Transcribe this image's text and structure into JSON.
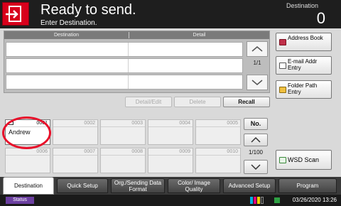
{
  "header": {
    "title": "Ready to send.",
    "subtitle": "Enter Destination.",
    "destination_label": "Destination",
    "destination_count": "0"
  },
  "table": {
    "columns": [
      "Destination",
      "Detail"
    ],
    "page_indicator": "1/1"
  },
  "side_buttons": [
    {
      "label": "Address Book"
    },
    {
      "label": "E-mail Addr Entry"
    },
    {
      "label": "Folder Path Entry"
    }
  ],
  "actions": {
    "detail_edit": "Detail/Edit",
    "delete": "Delete",
    "recall": "Recall"
  },
  "quick_keys": {
    "tiles": [
      {
        "number": "0001",
        "name": "Andrew",
        "active": true
      },
      {
        "number": "0002",
        "name": "",
        "active": false
      },
      {
        "number": "0003",
        "name": "",
        "active": false
      },
      {
        "number": "0004",
        "name": "",
        "active": false
      },
      {
        "number": "0005",
        "name": "",
        "active": false
      },
      {
        "number": "0006",
        "name": "",
        "active": false
      },
      {
        "number": "0007",
        "name": "",
        "active": false
      },
      {
        "number": "0008",
        "name": "",
        "active": false
      },
      {
        "number": "0009",
        "name": "",
        "active": false
      },
      {
        "number": "0010",
        "name": "",
        "active": false
      }
    ],
    "no_button": "No.",
    "page_indicator": "1/100",
    "wsd_scan": "WSD Scan"
  },
  "tabs": [
    {
      "label": "Destination",
      "active": true
    },
    {
      "label": "Quick Setup",
      "active": false
    },
    {
      "label": "Org./Sending Data Format",
      "active": false
    },
    {
      "label": "Color/ Image Quality",
      "active": false
    },
    {
      "label": "Advanced Setup",
      "active": false
    },
    {
      "label": "Program",
      "active": false
    }
  ],
  "status_bar": {
    "status_label": "Status",
    "datetime": "03/26/2020 13:26"
  },
  "colors": {
    "accent_red": "#d8001c",
    "highlight_ring": "#e8102a",
    "status_purple": "#6b3fa0"
  }
}
